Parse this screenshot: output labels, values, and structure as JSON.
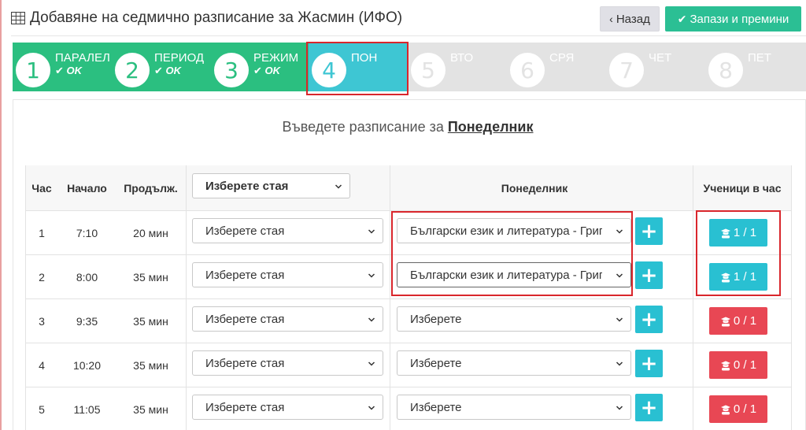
{
  "header": {
    "title": "Добавяне на седмично разписание за Жасмин (ИФО)",
    "back_label": "Назад",
    "save_label": "Запази и премини"
  },
  "wizard": {
    "steps": [
      {
        "num": "1",
        "label": "ПАРАЛЕЛ",
        "status": "OK"
      },
      {
        "num": "2",
        "label": "ПЕРИОД",
        "status": "OK"
      },
      {
        "num": "3",
        "label": "РЕЖИМ",
        "status": "OK"
      },
      {
        "num": "4",
        "label": "ПОН",
        "status": ""
      },
      {
        "num": "5",
        "label": "ВТО",
        "status": ""
      },
      {
        "num": "6",
        "label": "СРЯ",
        "status": ""
      },
      {
        "num": "7",
        "label": "ЧЕТ",
        "status": ""
      },
      {
        "num": "8",
        "label": "ПЕТ",
        "status": ""
      }
    ],
    "active_step": 4
  },
  "panel": {
    "subtitle_prefix": "Въведете разписание за",
    "subtitle_day": "Понеделник"
  },
  "table": {
    "headers": {
      "hour": "Час",
      "start": "Начало",
      "duration": "Продълж.",
      "room_select": "Изберете стая",
      "day": "Понеделник",
      "students": "Ученици в час"
    },
    "rows": [
      {
        "hour": "1",
        "start": "7:10",
        "duration": "20 мин",
        "room": "Изберете стая",
        "subject": "Български език и литература - Григо",
        "students": "1 / 1",
        "status": "ok"
      },
      {
        "hour": "2",
        "start": "8:00",
        "duration": "35 мин",
        "room": "Изберете стая",
        "subject": "Български език и литература - Григо",
        "students": "1 / 1",
        "status": "ok"
      },
      {
        "hour": "3",
        "start": "9:35",
        "duration": "35 мин",
        "room": "Изберете стая",
        "subject": "Изберете",
        "students": "0 / 1",
        "status": "bad"
      },
      {
        "hour": "4",
        "start": "10:20",
        "duration": "35 мин",
        "room": "Изберете стая",
        "subject": "Изберете",
        "students": "0 / 1",
        "status": "bad"
      },
      {
        "hour": "5",
        "start": "11:05",
        "duration": "35 мин",
        "room": "Изберете стая",
        "subject": "Изберете",
        "students": "0 / 1",
        "status": "bad"
      }
    ]
  },
  "colors": {
    "done": "#2bbf80",
    "active": "#3ec6d3",
    "pending": "#e3e3e3",
    "ok_button": "#29c0d2",
    "bad_button": "#e84754",
    "highlight": "#d9262c"
  },
  "icons": {
    "title": "table-icon",
    "back": "chevron-left-icon",
    "save": "check-icon",
    "add": "plus-icon",
    "students": "student-icon"
  }
}
